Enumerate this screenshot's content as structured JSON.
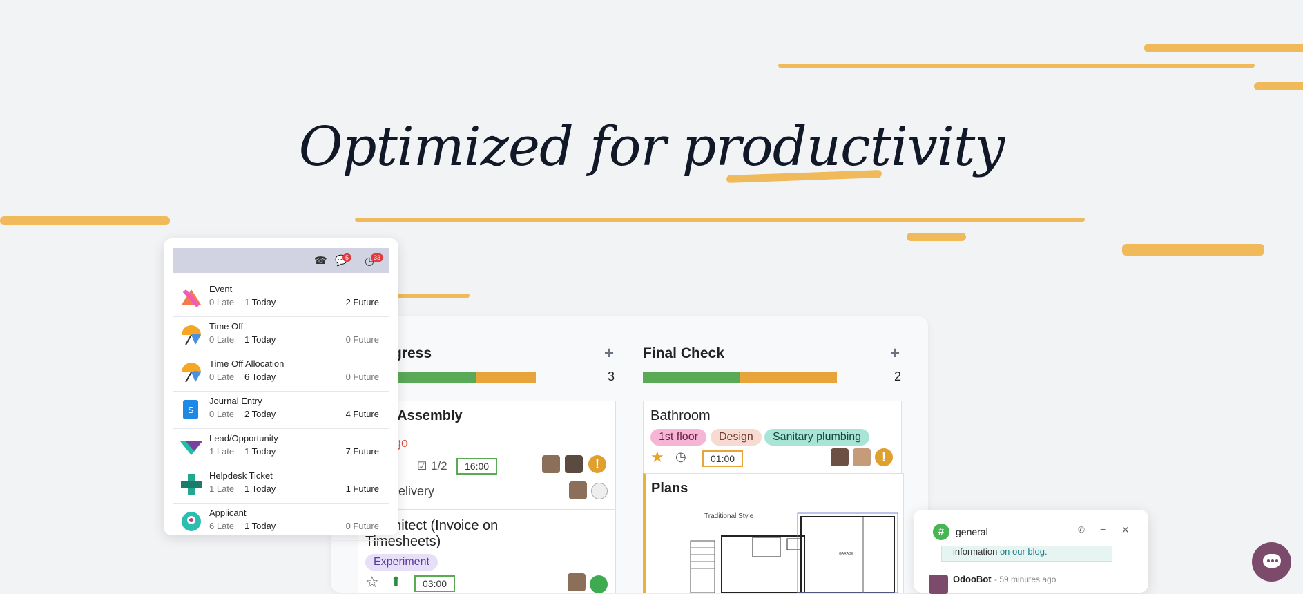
{
  "headline": {
    "before": "Optimized for ",
    "emph": "productivity"
  },
  "colors": {
    "accent_stroke": "#f0b95a",
    "progress_green": "#5aa957",
    "progress_orange": "#e6a43a",
    "odoo_purple": "#7c4b6b"
  },
  "kanban": {
    "col1": {
      "title": "gress",
      "count": "3",
      "progress": {
        "green": 0.55,
        "orange": 0.36
      },
      "card1": {
        "title": "en Assembly",
        "due": "s ago",
        "checklist": "1/2",
        "time": "16:00",
        "next": "te delivery"
      },
      "card2": {
        "title_line1": "r Architect (Invoice on",
        "title_line2": "Timesheets)",
        "tag": "Experiment",
        "time": "03:00"
      }
    },
    "col2": {
      "title": "Final Check",
      "count": "2",
      "progress": {
        "green": 0.5,
        "orange": 0.5
      },
      "card1": {
        "title": "Bathroom",
        "tags": [
          "1st floor",
          "Design",
          "Sanitary plumbing"
        ],
        "time": "01:00"
      },
      "card2": {
        "title": "Plans",
        "plan_label": "Traditional Style"
      }
    }
  },
  "activity": {
    "icons": [
      "phone-icon",
      "chat-icon",
      "clock-icon"
    ],
    "badges": {
      "messages": "5",
      "activities": "33"
    },
    "rows": [
      {
        "name": "Event",
        "late": "0 Late",
        "today": "1 Today",
        "future": "2 Future",
        "future_dim": false,
        "icon": "event-icon"
      },
      {
        "name": "Time Off",
        "late": "0 Late",
        "today": "1 Today",
        "future": "0 Future",
        "future_dim": true,
        "icon": "umbrella-icon"
      },
      {
        "name": "Time Off Allocation",
        "late": "0 Late",
        "today": "6 Today",
        "future": "0 Future",
        "future_dim": true,
        "icon": "umbrella-icon"
      },
      {
        "name": "Journal Entry",
        "late": "0 Late",
        "today": "2 Today",
        "future": "4 Future",
        "future_dim": false,
        "icon": "invoice-icon"
      },
      {
        "name": "Lead/Opportunity",
        "late": "1 Late",
        "today": "1 Today",
        "future": "7 Future",
        "future_dim": false,
        "icon": "crm-icon"
      },
      {
        "name": "Helpdesk Ticket",
        "late": "1 Late",
        "today": "1 Today",
        "future": "1 Future",
        "future_dim": false,
        "icon": "helpdesk-icon"
      },
      {
        "name": "Applicant",
        "late": "6 Late",
        "today": "1 Today",
        "future": "0 Future",
        "future_dim": true,
        "icon": "recruitment-icon"
      }
    ]
  },
  "chat": {
    "channel": "general",
    "msg_text": "information",
    "msg_link": "on our blog.",
    "author": "OdooBot",
    "time": "- 59 minutes ago"
  }
}
